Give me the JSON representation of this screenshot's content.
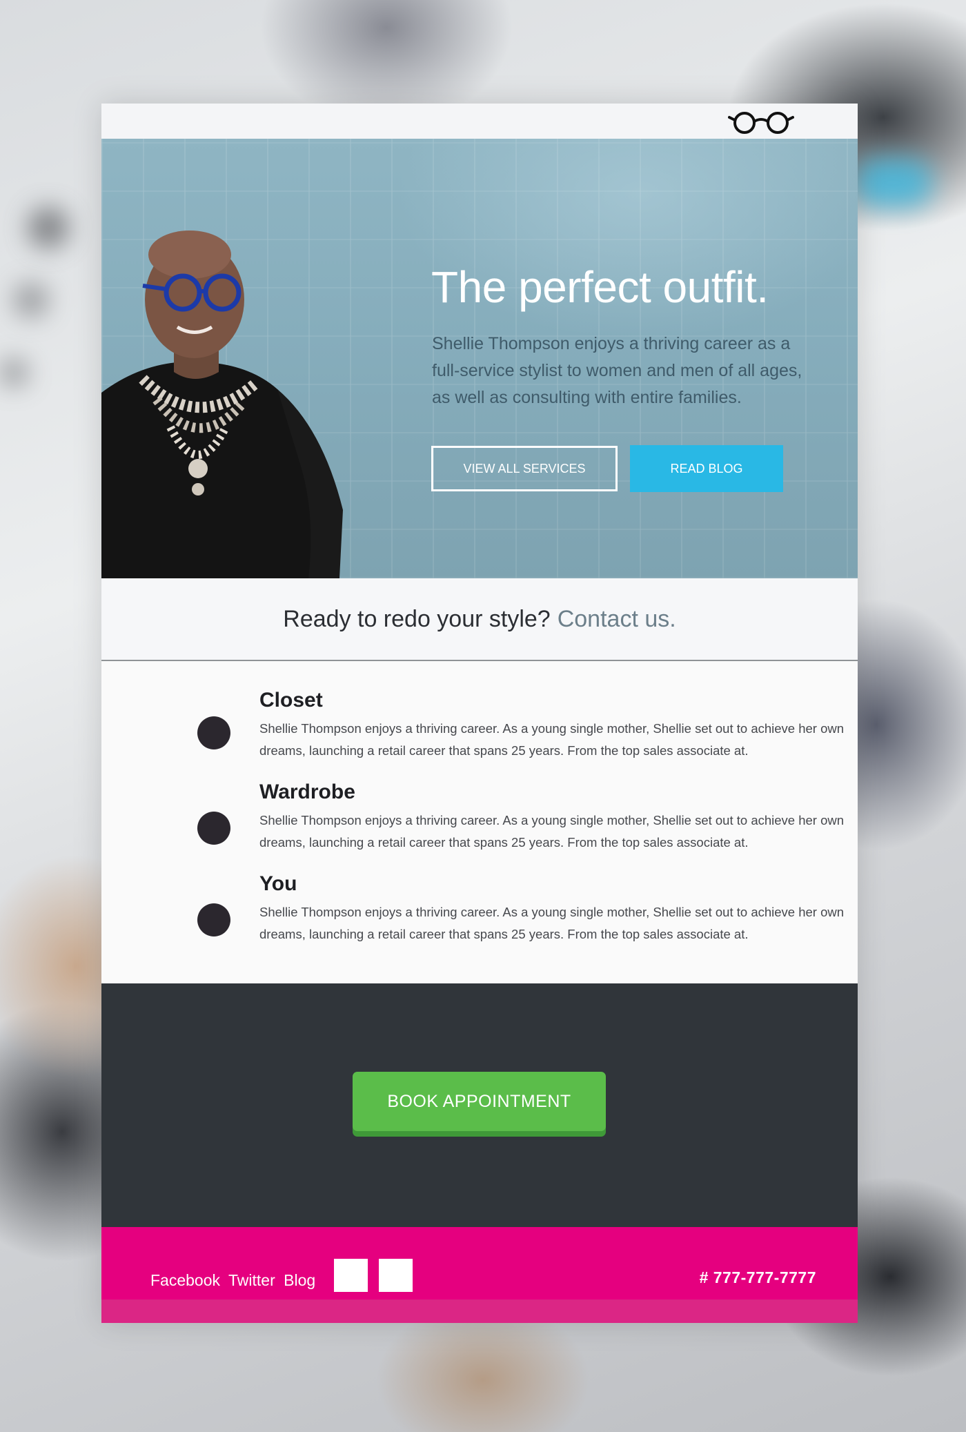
{
  "hero": {
    "title": "The perfect outfit.",
    "description": "Shellie Thompson enjoys a thriving career as a full-service stylist to women and men of all ages, as well as consulting with entire families.",
    "view_services_label": "VIEW ALL SERVICES",
    "read_blog_label": "READ BLOG"
  },
  "cta": {
    "question": "Ready to redo your style?",
    "link_text": "Contact us."
  },
  "features": [
    {
      "title": "Closet",
      "description": "Shellie Thompson enjoys a thriving career. As a young single mother, Shellie set out to achieve her own dreams, launching a retail career that spans 25 years. From the top sales associate at."
    },
    {
      "title": "Wardrobe",
      "description": "Shellie Thompson enjoys a thriving career. As a young single mother, Shellie set out to achieve her own dreams, launching a retail career that spans 25 years. From the top sales associate at."
    },
    {
      "title": "You",
      "description": "Shellie Thompson enjoys a thriving career. As a young single mother, Shellie set out to achieve her own dreams, launching a retail career that spans 25 years. From the top sales associate at."
    }
  ],
  "booking": {
    "button_label": "BOOK APPOINTMENT"
  },
  "footer": {
    "links": [
      "Facebook",
      "Twitter",
      "Blog"
    ],
    "phone": "# 777-777-7777"
  },
  "icons": {
    "logo": "glasses-icon",
    "feature_bullet": "circle-icon"
  },
  "colors": {
    "accent_blue": "#29b8e5",
    "book_green": "#5bbd4a",
    "footer_pink": "#e5007f",
    "dark_band": "#30353a"
  }
}
